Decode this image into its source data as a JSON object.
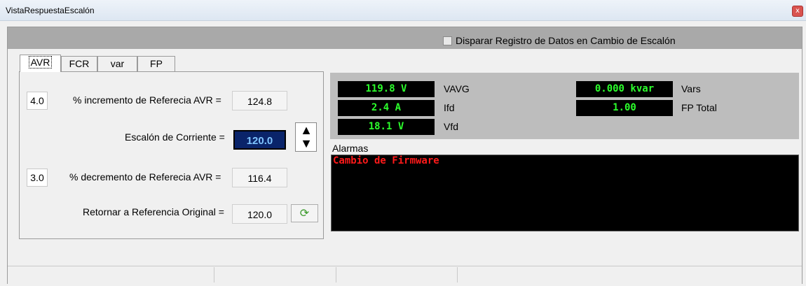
{
  "window": {
    "title": "VistaRespuestaEscalón",
    "close_glyph": "x"
  },
  "header": {
    "trigger_label": "Disparar Registro de Datos en Cambio de Escalón",
    "trigger_checked": false
  },
  "tabs": [
    {
      "label": "AVR",
      "active": true
    },
    {
      "label": "FCR",
      "active": false
    },
    {
      "label": "var",
      "active": false
    },
    {
      "label": "FP",
      "active": false
    }
  ],
  "avr": {
    "increment_input": "4.0",
    "increment_label": "% incremento de Referecia AVR =",
    "increment_value": "124.8",
    "step_label": "Escalón de Corriente =",
    "step_value": "120.0",
    "decrement_input": "3.0",
    "decrement_label": "% decremento de Referecia AVR =",
    "decrement_value": "116.4",
    "return_label": "Retornar a Referencia Original =",
    "return_value": "120.0",
    "refresh_icon": "refresh-icon",
    "stepper_up_glyph": "▲",
    "stepper_down_glyph": "▼",
    "refresh_glyph": "⟳"
  },
  "meters": {
    "vavg_value": "119.8 V",
    "vavg_label": "VAVG",
    "ifd_value": "2.4 A",
    "ifd_label": "Ifd",
    "vfd_value": "18.1 V",
    "vfd_label": "Vfd",
    "vars_value": "0.000 kvar",
    "vars_label": "Vars",
    "fp_value": "1.00",
    "fp_label": "FP Total"
  },
  "alarms": {
    "title": "Alarmas",
    "messages": [
      "Cambio de Firmware"
    ]
  },
  "colors": {
    "meter_text": "#2cff2c",
    "alarm_text": "#ff1a1a",
    "step_value_bg": "#0a246a"
  }
}
